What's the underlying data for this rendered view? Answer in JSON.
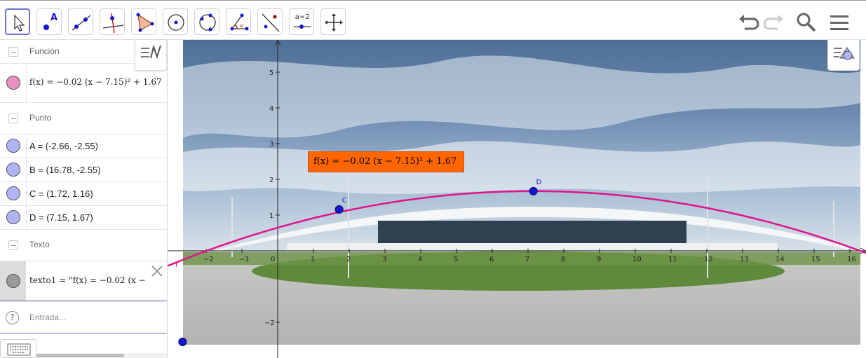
{
  "toolbar": {
    "tools": [
      "move-tool",
      "point-tool",
      "line-tool",
      "perpendicular-line-tool",
      "polygon-tool",
      "circle-center-point-tool",
      "circle-three-points-tool",
      "angle-tool",
      "reflect-about-line-tool",
      "slider-tool",
      "move-graphics-view-tool"
    ],
    "slider_label": "a=2",
    "point_letter": "A",
    "right_controls": [
      "undo-icon",
      "redo-icon",
      "search-icon",
      "menu-icon"
    ]
  },
  "algebra": {
    "groups": [
      {
        "label": "Función",
        "items": [
          {
            "text": "f(x) = −0.02 (x − 7.15)² + 1.67",
            "color": "#e890c0"
          }
        ]
      },
      {
        "label": "Punto",
        "items": [
          {
            "text": "A = (-2.66, -2.55)",
            "color": "#b0b4f4"
          },
          {
            "text": "B = (16.78, -2.55)",
            "color": "#b0b4f4"
          },
          {
            "text": "C = (1.72, 1.16)",
            "color": "#b0b4f4"
          },
          {
            "text": "D = (7.15, 1.67)",
            "color": "#b0b4f4"
          }
        ]
      },
      {
        "label": "Texto",
        "items": [
          {
            "text": "texto1 = \"f(x) = −0.02 (x −",
            "color": "#9a9a9a"
          }
        ]
      }
    ],
    "input_placeholder": "Entrada..."
  },
  "graphics": {
    "function_label": "f(x) = −0.02 (x − 7.15)² + 1.67",
    "curve_name": "f",
    "curve_color": "#e0148c",
    "point_color": "#1515d0",
    "text_bg_color": "#ff6600",
    "x_ticks": [
      "−2",
      "−1",
      "0",
      "1",
      "2",
      "3",
      "4",
      "5",
      "6",
      "7",
      "8",
      "9",
      "10",
      "11",
      "12",
      "13",
      "14",
      "15",
      "16"
    ],
    "y_ticks": [
      "5",
      "4",
      "3",
      "2",
      "1",
      "−2"
    ],
    "points": [
      {
        "name": "C",
        "x": 1.72,
        "y": 1.16
      },
      {
        "name": "D",
        "x": 7.15,
        "y": 1.67
      },
      {
        "name": "A",
        "x": -2.66,
        "y": -2.55
      }
    ],
    "function": {
      "a": -0.02,
      "h": 7.15,
      "k": 1.67
    }
  }
}
